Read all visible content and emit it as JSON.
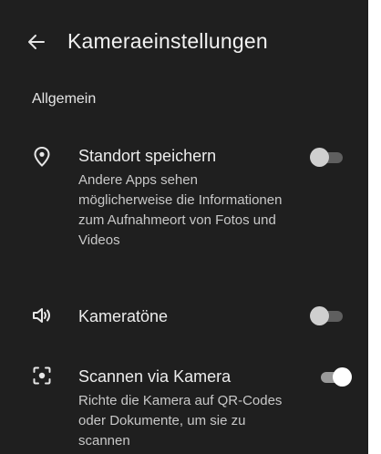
{
  "header": {
    "title": "Kameraeinstellungen",
    "back_icon": "arrow-left-icon"
  },
  "section": {
    "label": "Allgemein"
  },
  "settings": [
    {
      "icon": "location-pin-icon",
      "title": "Standort speichern",
      "summary": "Andere Apps sehen möglicherweise die Informationen zum Aufnahmeort von Fotos und Videos",
      "enabled": false
    },
    {
      "icon": "speaker-icon",
      "title": "Kameratöne",
      "summary": "",
      "enabled": false
    },
    {
      "icon": "scan-icon",
      "title": "Scannen via Kamera",
      "summary": "Richte die Kamera auf QR-Codes oder Dokumente, um sie zu scannen",
      "enabled": true
    }
  ],
  "colors": {
    "background": "#1f1f1f",
    "text_primary": "#ececec",
    "switch_on_thumb": "#ffffff",
    "switch_off_thumb": "#cfcfcf"
  }
}
